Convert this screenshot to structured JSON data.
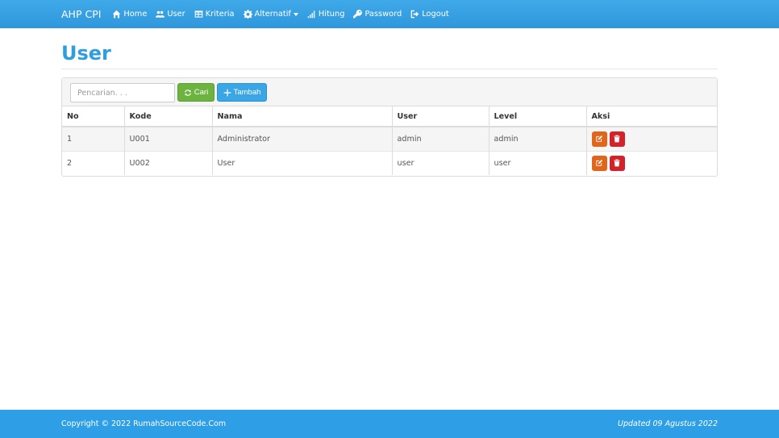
{
  "nav": {
    "brand": "AHP CPI",
    "items": [
      {
        "label": "Home",
        "icon": "home-icon"
      },
      {
        "label": "User",
        "icon": "users-icon"
      },
      {
        "label": "Kriteria",
        "icon": "table-icon"
      },
      {
        "label": "Alternatif",
        "icon": "gear-icon"
      },
      {
        "label": "Hitung",
        "icon": "signal-icon"
      },
      {
        "label": "Password",
        "icon": "key-icon"
      },
      {
        "label": "Logout",
        "icon": "logout-icon"
      }
    ]
  },
  "page": {
    "title": "User"
  },
  "toolbar": {
    "search_placeholder": "Pencarian. . .",
    "search_value": "",
    "cari_label": "Cari",
    "tambah_label": "Tambah"
  },
  "table": {
    "headers": [
      "No",
      "Kode",
      "Nama",
      "User",
      "Level",
      "Aksi"
    ],
    "rows": [
      [
        "1",
        "U001",
        "Administrator",
        "admin",
        "admin"
      ],
      [
        "2",
        "U002",
        "User",
        "user",
        "user"
      ]
    ]
  },
  "colors": {
    "navbar": "#2f97dc",
    "title": "#2f9ee0",
    "btn_cari": "#6db33f",
    "btn_tambah": "#3aa6e6",
    "edit": "#e2651c",
    "delete": "#d2232a",
    "footer": "#2e9fe6"
  },
  "footer": {
    "copyright": "Copyright © 2022 RumahSourceCode.Com",
    "updated": "Updated 09 Agustus 2022"
  }
}
